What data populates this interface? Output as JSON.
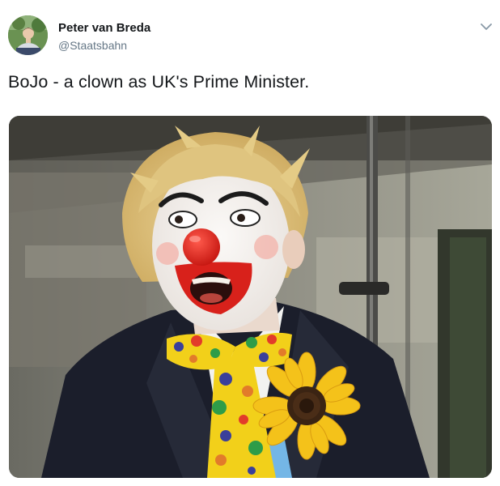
{
  "tweet": {
    "author_name": "Peter van Breda",
    "author_handle": "@Staatsbahn",
    "text": "BoJo - a clown as UK's Prime Minister.",
    "avatar_icon": "user-photo-avatar",
    "menu_icon": "chevron-down-icon"
  },
  "media": {
    "subject": "clown-portrait-photo",
    "colors": {
      "face_paint": "#f4f1ee",
      "nose": "#e0231c",
      "hair": "#d9bd73",
      "bowtie": "#f2d01a",
      "sunflower": "#f4c21a",
      "suit": "#1b1e2b"
    }
  }
}
